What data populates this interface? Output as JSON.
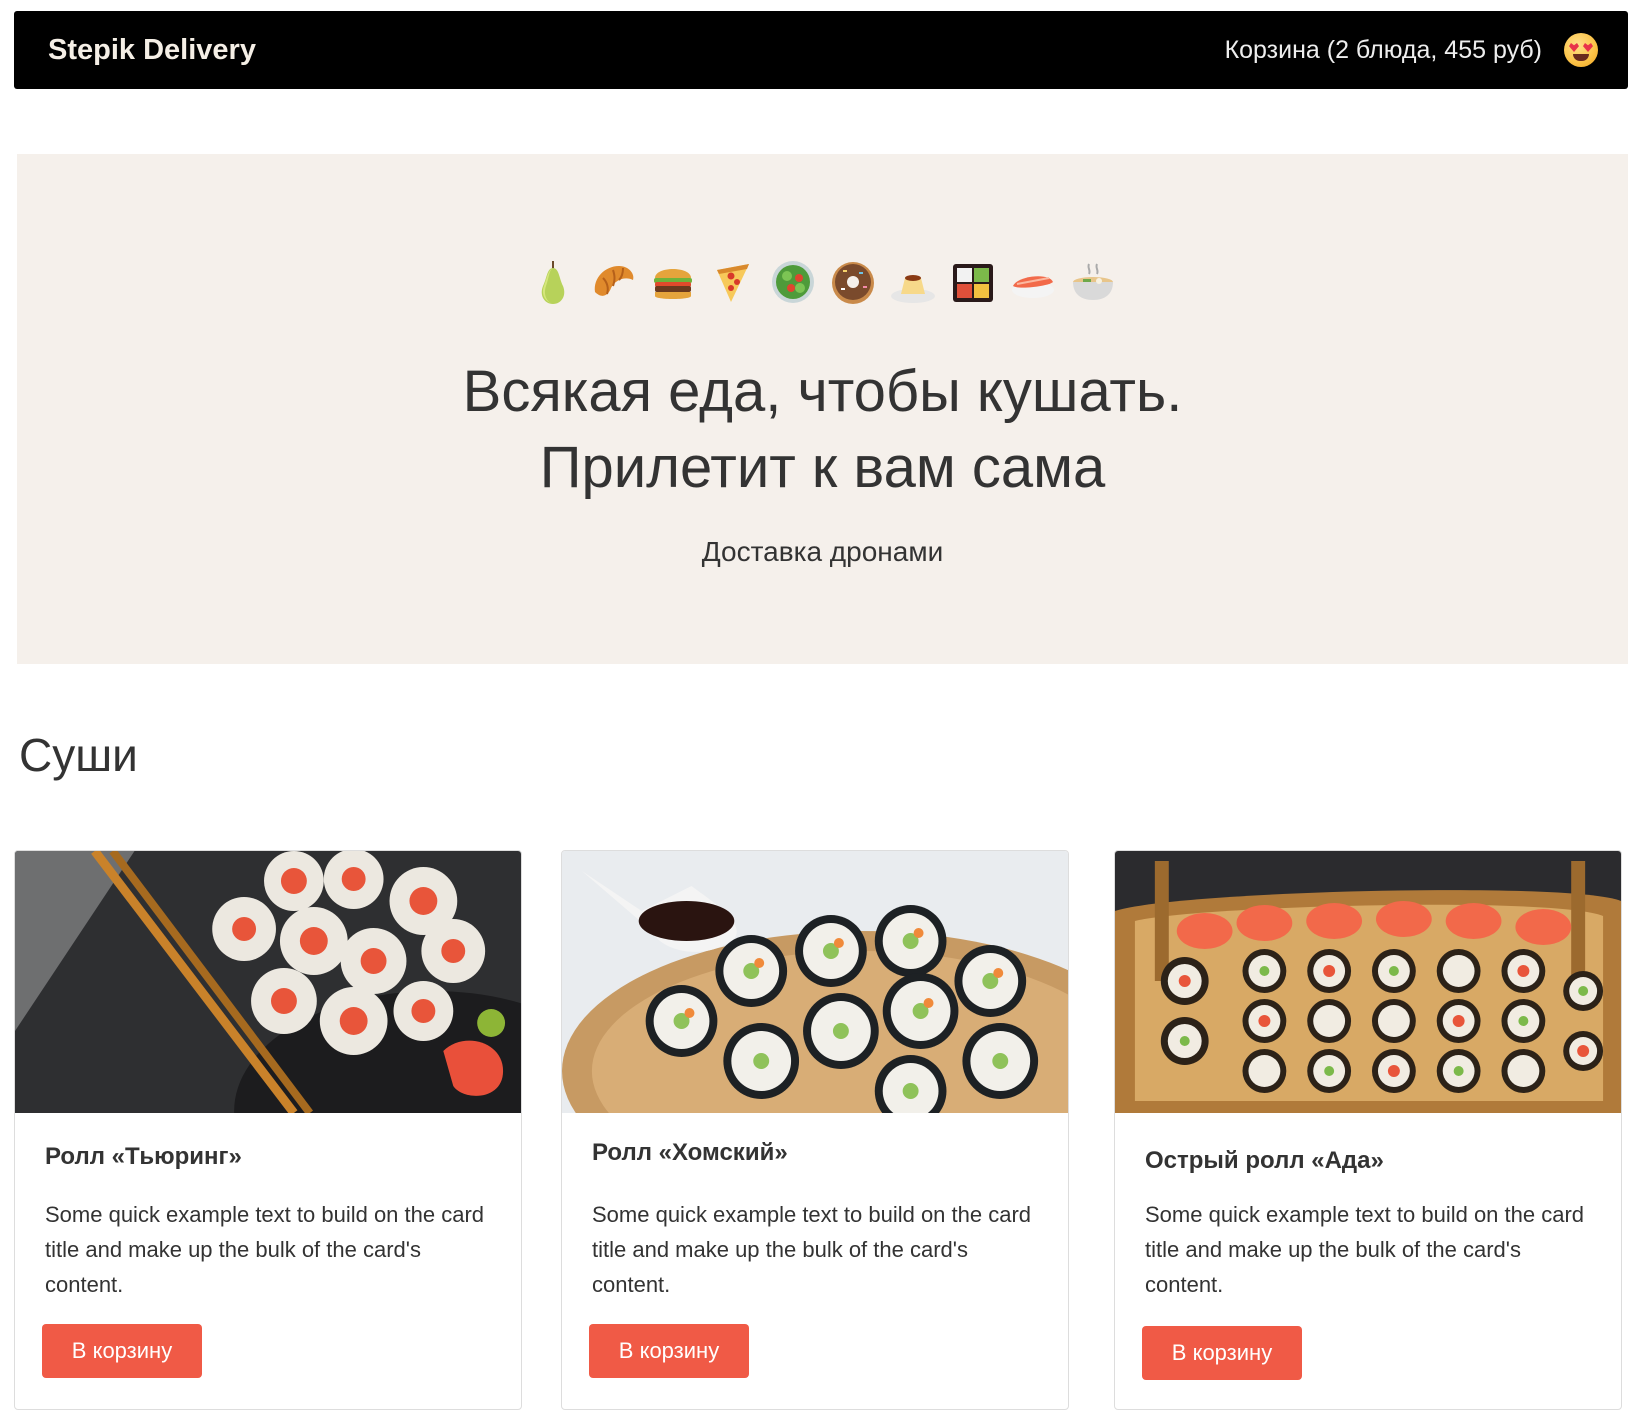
{
  "navbar": {
    "brand": "Stepik Delivery",
    "cart": "Корзина (2 блюда, 455 руб)",
    "cart_icon": "heart-eyes-emoji-icon"
  },
  "hero": {
    "emojis": [
      "pear",
      "croissant",
      "hamburger",
      "pizza",
      "green-salad",
      "doughnut",
      "custard",
      "bento-box",
      "sushi",
      "ramen-bowl"
    ],
    "title_line1": "Всякая еда, чтобы кушать.",
    "title_line2": "Прилетит к вам сама",
    "subtitle": "Доставка дронами"
  },
  "section": {
    "title": "Суши"
  },
  "cards": [
    {
      "title": "Ролл «Тьюринг»",
      "text": "Some quick example text to build on the card title and make up the bulk of the card's content.",
      "button": "В корзину"
    },
    {
      "title": "Ролл «Хомский»",
      "text": "Some quick example text to build on the card title and make up the bulk of the card's content.",
      "button": "В корзину"
    },
    {
      "title": "Острый ролл «Ада»",
      "text": "Some quick example text to build on the card title and make up the bulk of the card's content.",
      "button": "В корзину"
    }
  ],
  "colors": {
    "navbar_bg": "#000000",
    "hero_bg": "#f5f0eb",
    "button_bg": "#f05a46"
  }
}
